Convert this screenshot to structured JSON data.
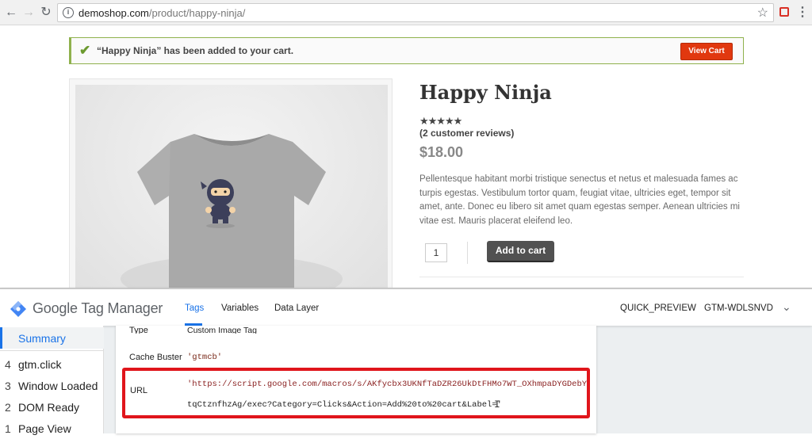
{
  "browser": {
    "url_domain": "demoshop.com",
    "url_path": "/product/happy-ninja/",
    "back_icon": "back-arrow-icon",
    "forward_icon": "forward-arrow-icon",
    "reload_icon": "reload-icon"
  },
  "notice": {
    "message": "“Happy Ninja” has been added to your cart.",
    "button": "View Cart",
    "accent_color": "#8fb14d"
  },
  "product": {
    "title": "Happy Ninja",
    "stars": "★★★★★",
    "rating": 5,
    "reviews": "(2 customer reviews)",
    "price": "$18.00",
    "description": "Pellentesque habitant morbi tristique senectus et netus et malesuada fames ac turpis egestas. Vestibulum tortor quam, feugiat vitae, ultricies eget, tempor sit amet, ante. Donec eu libero sit amet quam egestas semper. Aenean ultricies mi vitae est. Mauris placerat eleifend leo.",
    "quantity": "1",
    "add_to_cart": "Add to cart"
  },
  "gtm": {
    "app_name": "Google Tag Manager",
    "tabs": [
      "Tags",
      "Variables",
      "Data Layer"
    ],
    "active_tab": "Tags",
    "quick_preview": "QUICK_PREVIEW",
    "container_id": "GTM-WDLSNVD",
    "nav": {
      "summary": "Summary",
      "events": [
        {
          "num": "4",
          "label": "gtm.click"
        },
        {
          "num": "3",
          "label": "Window Loaded"
        },
        {
          "num": "2",
          "label": "DOM Ready"
        },
        {
          "num": "1",
          "label": "Page View"
        }
      ]
    },
    "details": {
      "type_label": "Type",
      "type_value": "Custom Image Tag",
      "cache_buster_label": "Cache Buster",
      "cache_buster_value": "'gtmcb'",
      "url_label": "URL",
      "url_line1": "'https://script.google.com/macros/s/AKfycbx3UKNfTaDZR26UkDtFHMo7WT_OXhmpaDYGDebY",
      "url_line2": "tqCtznfhzAg/exec?Category=Clicks&Action=Add%20to%20cart&Label='"
    }
  }
}
